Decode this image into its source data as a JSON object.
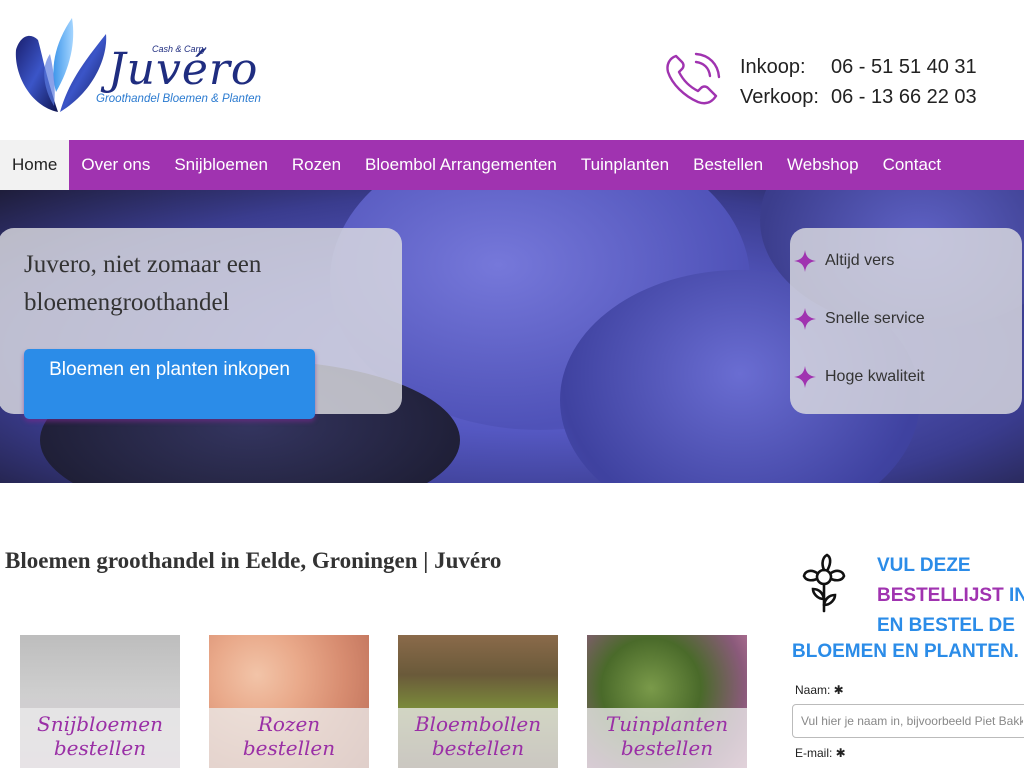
{
  "header": {
    "brand": "Juvéro",
    "brand_tag": "Cash & Carry",
    "brand_sub": "Groothandel Bloemen & Planten",
    "inkoop_label": "Inkoop:",
    "inkoop_phone": "06 - 51 51 40 31",
    "verkoop_label": "Verkoop:",
    "verkoop_phone": "06 - 13 66 22 03"
  },
  "nav": {
    "items": [
      {
        "label": "Home",
        "active": true
      },
      {
        "label": "Over ons"
      },
      {
        "label": "Snijbloemen"
      },
      {
        "label": "Rozen"
      },
      {
        "label": "Bloembol Arrangementen"
      },
      {
        "label": "Tuinplanten"
      },
      {
        "label": "Bestellen"
      },
      {
        "label": "Webshop"
      },
      {
        "label": "Contact"
      }
    ]
  },
  "hero": {
    "title": "Juvero, niet zomaar een bloemengroothandel",
    "button_label": "Bloemen en planten inkopen",
    "features": [
      "Altijd vers",
      "Snelle service",
      "Hoge kwaliteit"
    ]
  },
  "main": {
    "title": "Bloemen groothandel in Eelde, Groningen | Juvéro",
    "tiles": [
      {
        "label": "Snijbloemen bestellen"
      },
      {
        "label": "Rozen bestellen"
      },
      {
        "label": "Bloembollen bestellen"
      },
      {
        "label": "Tuinplanten bestellen"
      }
    ]
  },
  "order_form": {
    "title_part1": "VUL DEZE",
    "title_part2": "BESTELLIJST",
    "title_part3": "IN",
    "title_part4": "EN BESTEL DE",
    "title_part5": "BLOEMEN EN PLANTEN.",
    "name_label": "Naam: ✱",
    "name_placeholder": "Vul hier je naam in, bijvoorbeeld Piet Bakker",
    "email_label": "E-mail: ✱"
  },
  "colors": {
    "accent_purple": "#a033b0",
    "accent_blue": "#2b8ce8",
    "brand_navy": "#1f2d80"
  }
}
